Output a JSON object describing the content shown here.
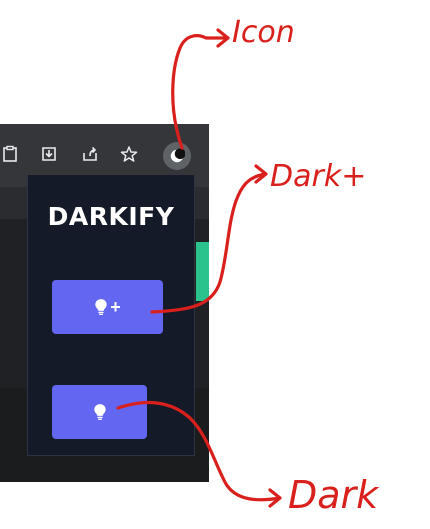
{
  "popup": {
    "title": "DARKIFY",
    "dark_plus_button": {
      "icon": "lightbulb-icon",
      "suffix": "+"
    },
    "dark_button": {
      "icon": "lightbulb-icon"
    }
  },
  "toolbar": {
    "icons": [
      "clipboard-icon",
      "download-icon",
      "share-icon",
      "star-icon",
      "moon-icon"
    ]
  },
  "annotations": {
    "icon_label": "Icon",
    "dark_plus_label": "Dark+",
    "dark_label": "Dark"
  },
  "colors": {
    "toolbar": "#35363a",
    "popup_bg": "#141a28",
    "button": "#6366f1",
    "annotation": "#d9201c",
    "green_tab": "#2bc38d"
  }
}
